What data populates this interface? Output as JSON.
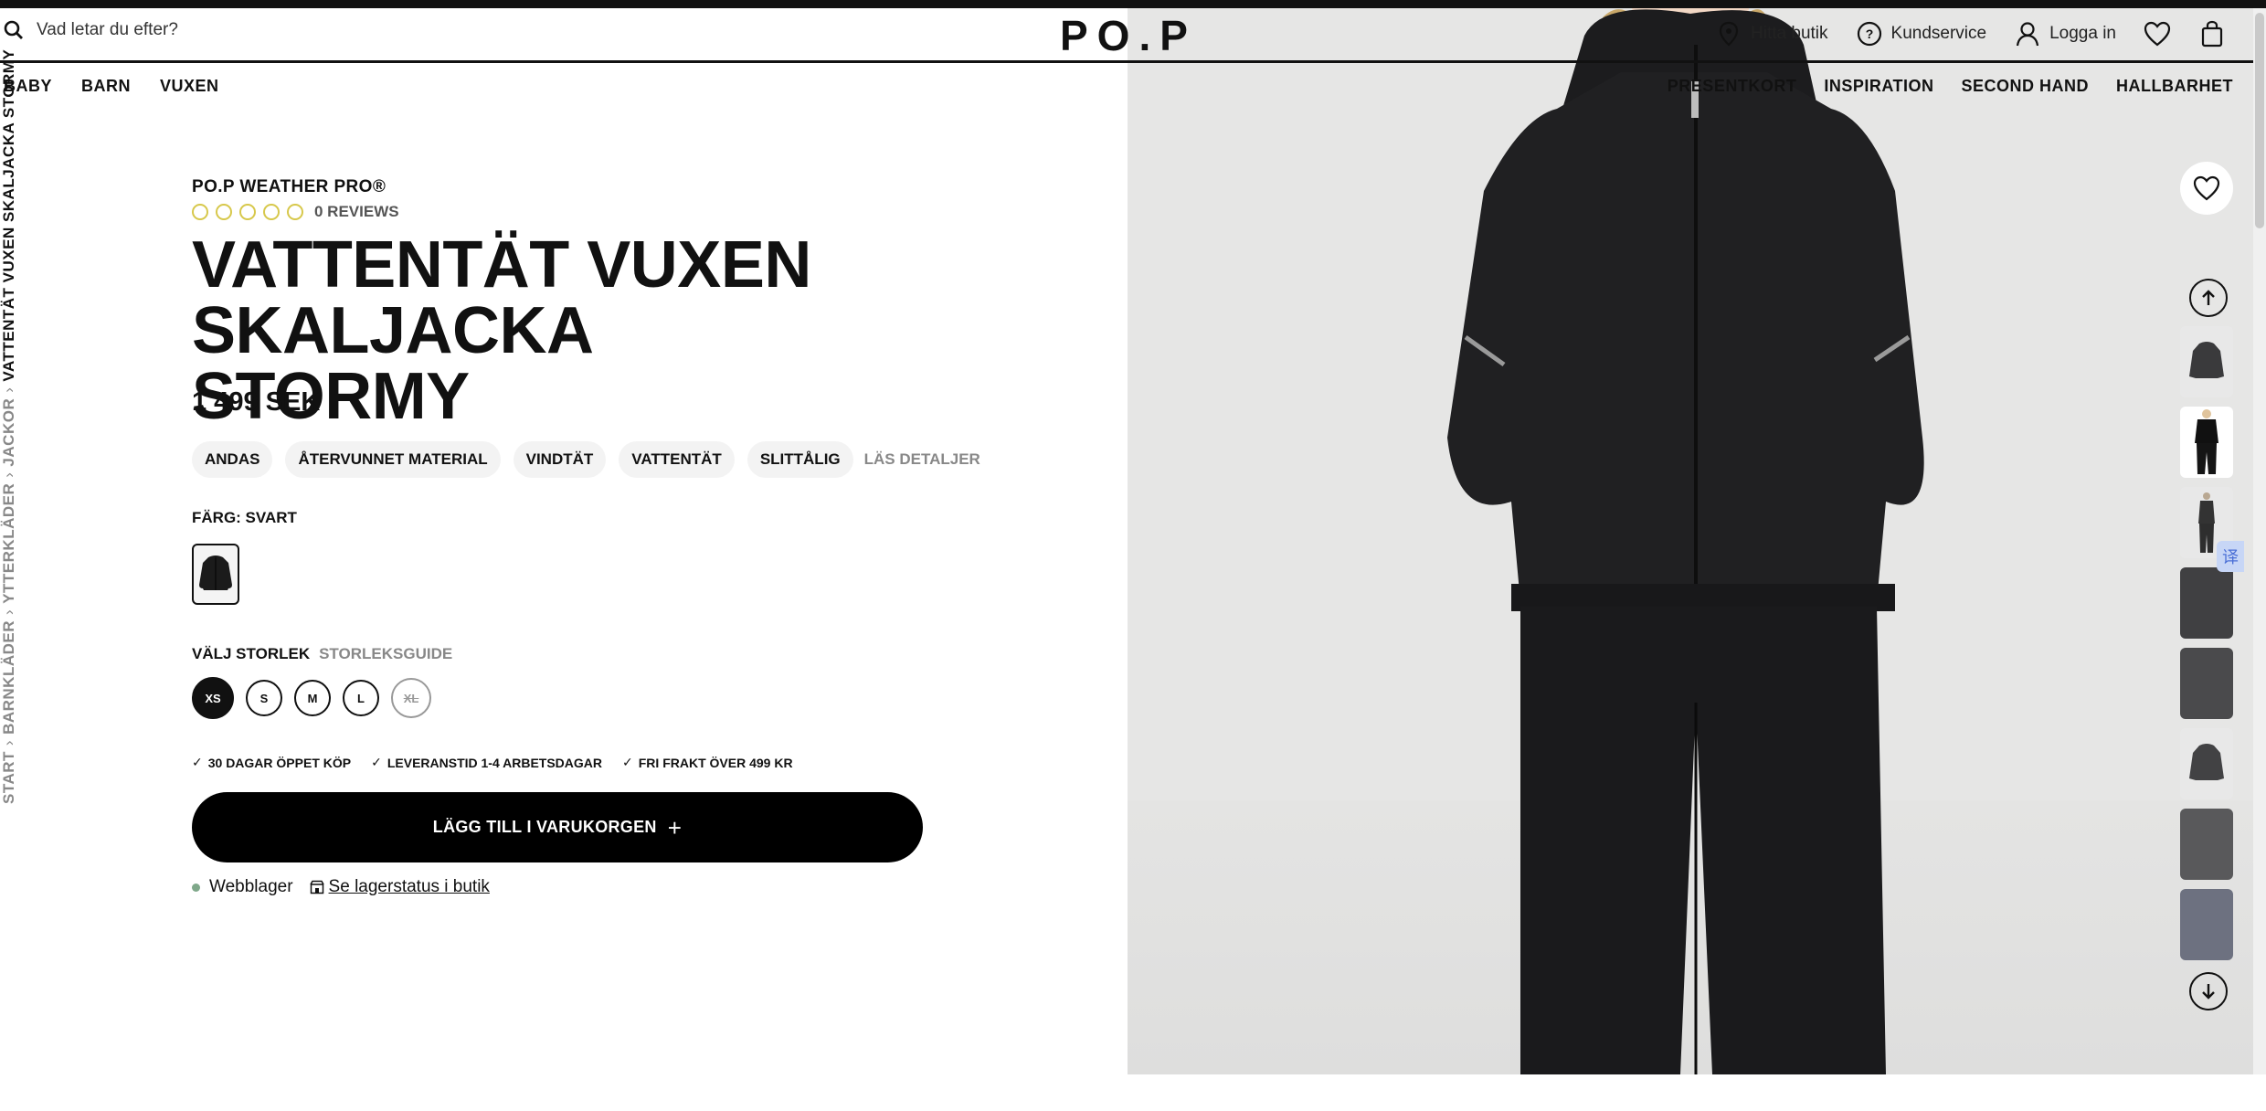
{
  "header": {
    "search_placeholder": "Vad letar du efter?",
    "logo": "PO.P",
    "utility": [
      {
        "label": "Hitta butik",
        "icon": "location-pin-icon"
      },
      {
        "label": "Kundservice",
        "icon": "question-circle-icon"
      },
      {
        "label": "Logga in",
        "icon": "user-icon"
      }
    ]
  },
  "nav_left": [
    "BABY",
    "BARN",
    "VUXEN"
  ],
  "nav_right": [
    "PRESENTKORT",
    "INSPIRATION",
    "SECOND HAND",
    "HALLBARHET"
  ],
  "breadcrumb": {
    "items": [
      "START",
      "BARNKLÄDER",
      "YTTERKLÄDER",
      "JACKOR"
    ],
    "current": "VATTENTÄT VUXEN SKALJACKA STORMY"
  },
  "product": {
    "brand": "PO.P WEATHER PRO®",
    "rating_stars": 0,
    "reviews": "0 REVIEWS",
    "title_line1": "VATTENTÄT VUXEN",
    "title_line2": "SKALJACKA STORMY",
    "price": "1 499 SEK",
    "features": [
      "ANDAS",
      "ÅTERVUNNET MATERIAL",
      "VINDTÄT",
      "VATTENTÄT",
      "SLITTÅLIG"
    ],
    "details_link": "LÄS DETALJER",
    "color_label": "FÄRG: SVART",
    "size_label": "VÄLJ STORLEK",
    "size_guide": "STORLEKSGUIDE",
    "sizes": [
      "XS",
      "S",
      "M",
      "L",
      "XL"
    ],
    "selected_size": "XS",
    "soldout_size": "XL",
    "perks": [
      "30 DAGAR ÖPPET KÖP",
      "LEVERANSTID 1-4 ARBETSDAGAR",
      "FRI FRAKT ÖVER 499 KR"
    ],
    "add_to_cart": "LÄGG TILL I VARUKORGEN",
    "stock_web": "Webblager",
    "stock_store_link": "Se lagerstatus i butik"
  },
  "gallery": {
    "thumbnail_count": 8,
    "translate_badge": "译"
  },
  "colors": {
    "accent_black": "#000000",
    "star_outline": "#d7c84b",
    "stock_dot": "#7fa88a",
    "muted_text": "#888888"
  }
}
